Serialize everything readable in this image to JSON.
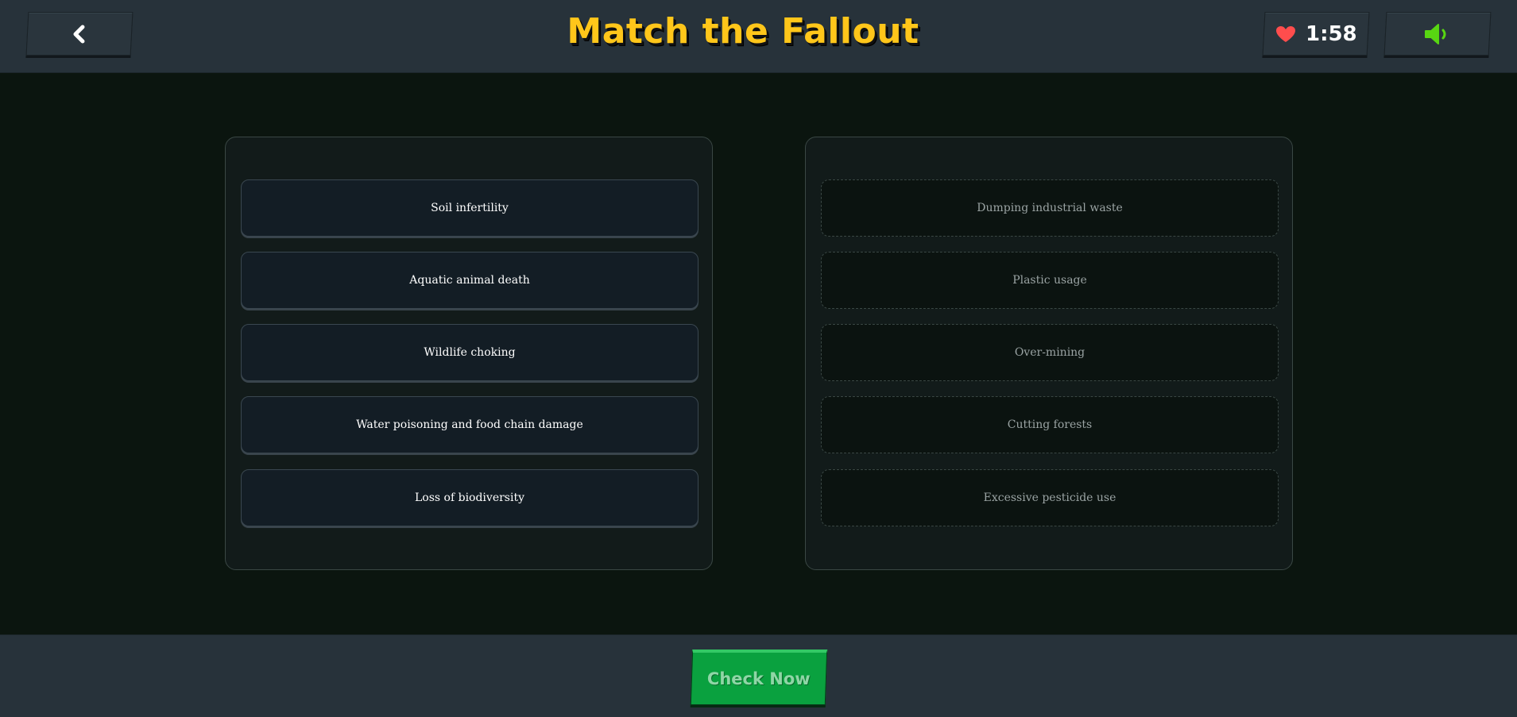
{
  "header": {
    "title": "Match the Fallout",
    "timer": "1:58",
    "back_icon": "chevron-left-icon",
    "life_icon": "heart-icon",
    "sound_icon": "speaker-on-icon"
  },
  "effects": [
    {
      "label": "Soil infertility"
    },
    {
      "label": "Aquatic animal death"
    },
    {
      "label": "Wildlife choking"
    },
    {
      "label": "Water poisoning and food chain damage"
    },
    {
      "label": "Loss of biodiversity"
    }
  ],
  "causes": [
    {
      "label": "Dumping industrial waste"
    },
    {
      "label": "Plastic usage"
    },
    {
      "label": "Over-mining"
    },
    {
      "label": "Cutting forests"
    },
    {
      "label": "Excessive pesticide use"
    }
  ],
  "footer": {
    "check_label": "Check Now"
  },
  "colors": {
    "title": "#ffc61a",
    "heart": "#ff4d4d",
    "speaker": "#58d612",
    "check_button": "#0aa13f",
    "background": "#0b150f",
    "bar": "#27323a"
  }
}
